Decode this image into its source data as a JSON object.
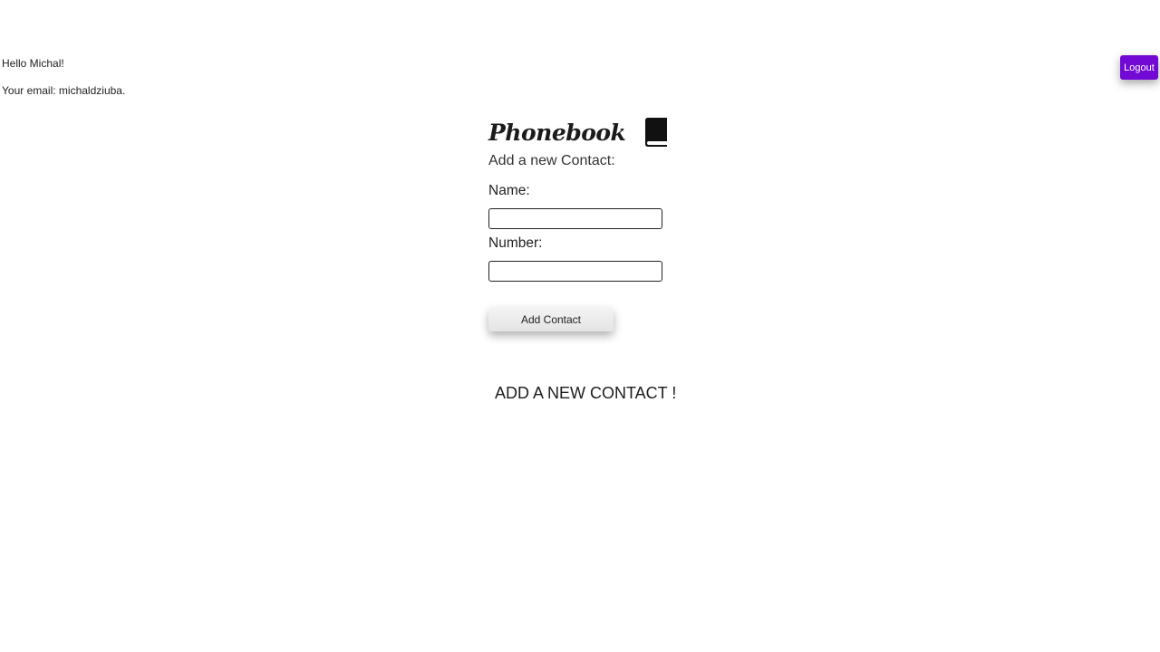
{
  "user": {
    "greeting": "Hello Michal!",
    "email_line": "Your email: michaldziuba."
  },
  "header": {
    "logout_label": "Logout",
    "logout_color": "#7209d4"
  },
  "app": {
    "title": "Phonebook",
    "title_icon": "book-icon",
    "subtitle": "Add a new Contact:"
  },
  "form": {
    "name_label": "Name:",
    "name_value": "",
    "number_label": "Number:",
    "number_value": "",
    "submit_label": "Add Contact"
  },
  "contacts": {
    "empty_message": "ADD A NEW CONTACT !"
  }
}
